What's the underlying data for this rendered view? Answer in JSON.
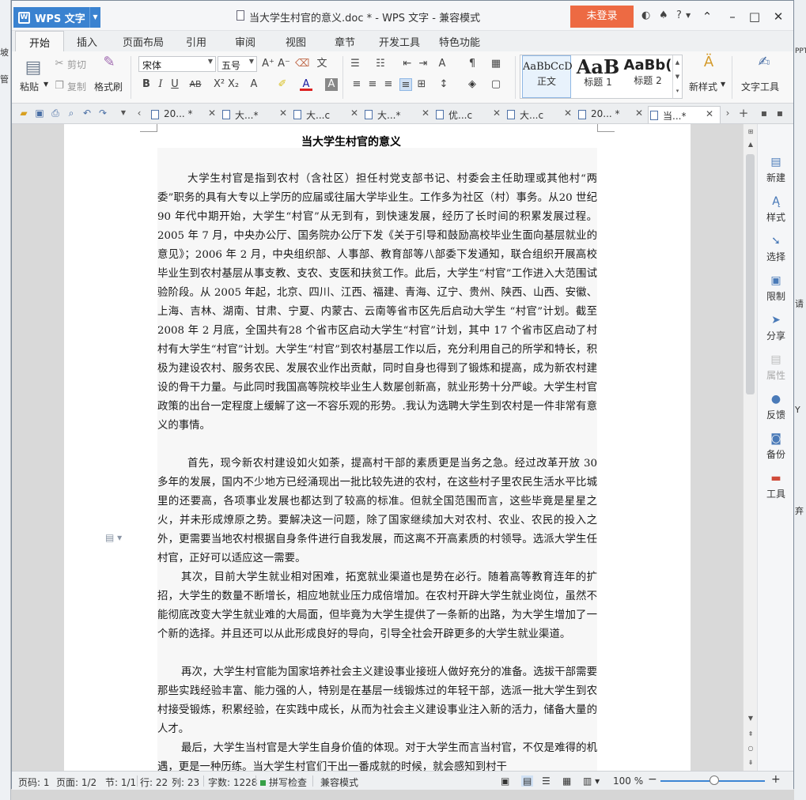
{
  "app": {
    "name": "WPS 文字",
    "window_title": "当大学生村官的意义.doc * - WPS 文字 - 兼容模式",
    "login_label": "未登录",
    "help_label": "?"
  },
  "desktop": {
    "left_labels": [
      "坡",
      "管"
    ],
    "right_labels": [
      "PPT",
      "请",
      "Y",
      "弃"
    ]
  },
  "menu_tabs": [
    "开始",
    "插入",
    "页面布局",
    "引用",
    "审阅",
    "视图",
    "章节",
    "开发工具",
    "特色功能"
  ],
  "ribbon": {
    "paste": "粘贴",
    "cut": "剪切",
    "copy": "复制",
    "format_painter": "格式刷",
    "font_name": "宋体",
    "font_size": "五号",
    "styles": [
      {
        "sample": "AaBbCcD",
        "label": "正文"
      },
      {
        "sample": "AaB",
        "label": "标题 1"
      },
      {
        "sample": "AaBb(",
        "label": "标题 2"
      }
    ],
    "new_style": "新样式",
    "text_tools": "文字工具"
  },
  "doc_tabs": [
    "20... *",
    "大...*",
    "大...c",
    "大...*",
    "优...c",
    "大...c",
    "20... *",
    "当...*"
  ],
  "document": {
    "title": "当大学生村官的意义",
    "paragraphs": [
      "大学生村官是指到农村（含社区）担任村党支部书记、村委会主任助理或其他村“两委”职务的具有大专以上学历的应届或往届大学毕业生。工作多为社区（村）事务。从20 世纪 90 年代中期开始，大学生“村官”从无到有，到快速发展，经历了长时间的积累发展过程。2005 年 7 月，中央办公厅、国务院办公厅下发《关于引导和鼓励高校毕业生面向基层就业的意见》；2006 年 2 月，中央组织部、人事部、教育部等八部委下发通知，联合组织开展高校毕业生到农村基层从事支教、支农、支医和扶贫工作。此后，大学生“村官”工作进入大范围试验阶段。从 2005 年起，北京、四川、江西、福建、青海、辽宁、贵州、陕西、山西、安徽、上海、吉林、湖南、甘肃、宁夏、内蒙古、云南等省市区先后启动大学生 “村官”计划。截至 2008 年 2 月底，全国共有28 个省市区启动大学生“村官”计划，其中 17 个省市区启动了村村有大学生“村官”计划。大学生“村官”到农村基层工作以后，充分利用自己的所学和特长，积极为建设农村、服务农民、发展农业作出贡献，同时自身也得到了锻炼和提高，成为新农村建设的骨干力量。与此同时我国高等院校毕业生人数屡创新高，就业形势十分严峻。大学生村官政策的出台一定程度上缓解了这一不容乐观的形势。.我认为选聘大学生到农村是一件非常有意义的事情。",
      "首先，现今新农村建设如火如荼，提高村干部的素质更是当务之急。经过改革开放 30 多年的发展，国内不少地方已经涌现出一批比较先进的农村，在这些村子里农民生活水平比城里的还要高，各项事业发展也都达到了较高的标准。但就全国范围而言，这些毕竟是星星之火，并未形成燎原之势。要解决这一问题，除了国家继续加大对农村、农业、农民的投入之外，更需要当地农村根据自身条件进行自我发展，而这离不开高素质的村领导。选派大学生任村官，正好可以适应这一需要。",
      "其次，目前大学生就业相对困难，拓宽就业渠道也是势在必行。随着高等教育连年的扩招，大学生的数量不断增长，相应地就业压力成倍增加。在农村开辟大学生就业岗位，虽然不能彻底改变大学生就业难的大局面，但毕竟为大学生提供了一条新的出路，为大学生增加了一个新的选择。并且还可以从此形成良好的导向，引导全社会开辟更多的大学生就业渠道。",
      "再次，大学生村官能为国家培养社会主义建设事业接班人做好充分的准备。选拔干部需要那些实践经验丰富、能力强的人，特别是在基层一线锻炼过的年轻干部，选派一批大学生到农村接受锻炼，积累经验，在实践中成长，从而为社会主义建设事业注入新的活力，储备大量的人才。",
      "最后，大学生当村官是大学生自身价值的体现。对于大学生而言当村官，不仅是难得的机遇，更是一种历练。当大学生村官们干出一番成就的时候，就会感知到村干"
    ]
  },
  "task_pane": [
    {
      "label": "新建",
      "icon": "new-doc-icon",
      "enabled": true
    },
    {
      "label": "样式",
      "icon": "style-icon",
      "enabled": true
    },
    {
      "label": "选择",
      "icon": "select-icon",
      "enabled": true
    },
    {
      "label": "限制",
      "icon": "restrict-icon",
      "enabled": true
    },
    {
      "label": "分享",
      "icon": "share-icon",
      "enabled": true
    },
    {
      "label": "属性",
      "icon": "properties-icon",
      "enabled": false
    },
    {
      "label": "反馈",
      "icon": "feedback-icon",
      "enabled": true
    },
    {
      "label": "备份",
      "icon": "backup-icon",
      "enabled": true
    },
    {
      "label": "工具",
      "icon": "toolbox-icon",
      "enabled": true
    }
  ],
  "status": {
    "page_code": "页码: 1",
    "pages": "页面: 1/2",
    "section": "节: 1/1",
    "row": "行: 22",
    "col": "列: 23",
    "word_count": "字数: 1228",
    "spell_check": "拼写检查",
    "mode": "兼容模式",
    "zoom": "100 %"
  },
  "colors": {
    "accent": "#3a82d0",
    "login": "#ed6a43"
  }
}
